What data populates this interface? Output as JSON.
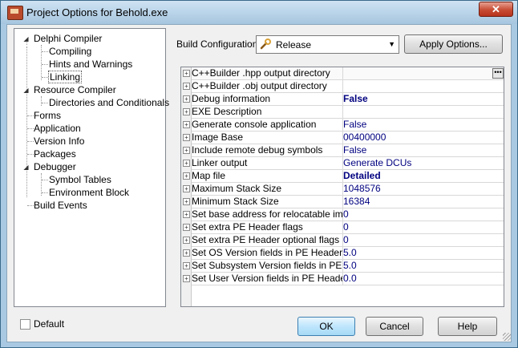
{
  "window": {
    "title": "Project Options for Behold.exe"
  },
  "tree": {
    "items": [
      {
        "label": "Delphi Compiler"
      },
      {
        "label": "Compiling"
      },
      {
        "label": "Hints and Warnings"
      },
      {
        "label": "Linking"
      },
      {
        "label": "Resource Compiler"
      },
      {
        "label": "Directories and Conditionals"
      },
      {
        "label": "Forms"
      },
      {
        "label": "Application"
      },
      {
        "label": "Version Info"
      },
      {
        "label": "Packages"
      },
      {
        "label": "Debugger"
      },
      {
        "label": "Symbol Tables"
      },
      {
        "label": "Environment Block"
      },
      {
        "label": "Build Events"
      }
    ]
  },
  "build_config": {
    "label": "Build Configuration",
    "selected": "Release",
    "apply_label": "Apply Options..."
  },
  "options": [
    {
      "name": "C++Builder .hpp output directory",
      "value": ""
    },
    {
      "name": "C++Builder .obj output directory",
      "value": ""
    },
    {
      "name": "Debug information",
      "value": "False"
    },
    {
      "name": "EXE Description",
      "value": ""
    },
    {
      "name": "Generate console application",
      "value": "False"
    },
    {
      "name": "Image Base",
      "value": "00400000"
    },
    {
      "name": "Include remote debug symbols",
      "value": "False"
    },
    {
      "name": "Linker output",
      "value": "Generate DCUs"
    },
    {
      "name": "Map file",
      "value": "Detailed"
    },
    {
      "name": "Maximum Stack Size",
      "value": "1048576"
    },
    {
      "name": "Minimum Stack Size",
      "value": "16384"
    },
    {
      "name": "Set base address for relocatable image",
      "value": "0"
    },
    {
      "name": "Set extra PE Header flags",
      "value": "0"
    },
    {
      "name": "Set extra PE Header optional flags",
      "value": "0"
    },
    {
      "name": "Set OS Version fields in PE Header as <",
      "value": "5.0"
    },
    {
      "name": "Set Subsystem Version fields in PE Header",
      "value": "5.0"
    },
    {
      "name": "Set User Version fields in PE Header as",
      "value": "0.0"
    }
  ],
  "footer": {
    "default_label": "Default",
    "ok_label": "OK",
    "cancel_label": "Cancel",
    "help_label": "Help"
  }
}
